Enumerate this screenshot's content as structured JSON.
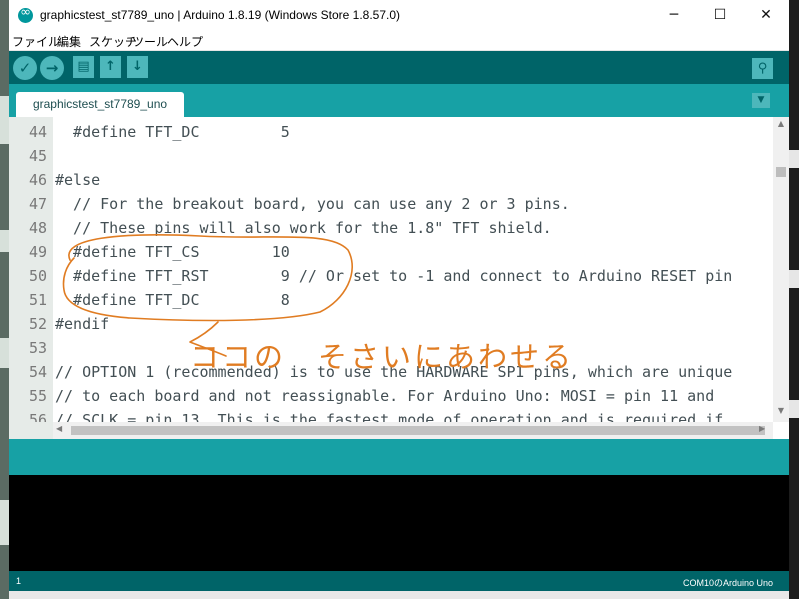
{
  "window": {
    "title": "graphicstest_st7789_uno | Arduino 1.8.19 (Windows Store 1.8.57.0)",
    "min_glyph": "─",
    "max_glyph": "☐",
    "close_glyph": "✕"
  },
  "menu": [
    "ファイル",
    "編集",
    "スケッチ",
    "ツール",
    "ヘルプ"
  ],
  "toolbar": {
    "verify_glyph": "✓",
    "upload_glyph": "→",
    "new_glyph": "▤",
    "open_glyph": "↑",
    "save_glyph": "↓",
    "serial_glyph": "⚲"
  },
  "tab": {
    "label": "graphicstest_st7789_uno",
    "menu_glyph": "▼"
  },
  "code_lines": [
    {
      "num": "44",
      "text": "  #define TFT_DC         5"
    },
    {
      "num": "45",
      "text": ""
    },
    {
      "num": "46",
      "text": "#else"
    },
    {
      "num": "47",
      "text": "  // For the breakout board, you can use any 2 or 3 pins."
    },
    {
      "num": "48",
      "text": "  // These pins will also work for the 1.8\" TFT shield."
    },
    {
      "num": "49",
      "text": "  #define TFT_CS        10"
    },
    {
      "num": "50",
      "text": "  #define TFT_RST        9 // Or set to -1 and connect to Arduino RESET pin"
    },
    {
      "num": "51",
      "text": "  #define TFT_DC         8"
    },
    {
      "num": "52",
      "text": "#endif"
    },
    {
      "num": "53",
      "text": ""
    },
    {
      "num": "54",
      "text": "// OPTION 1 (recommended) is to use the HARDWARE SPI pins, which are unique"
    },
    {
      "num": "55",
      "text": "// to each board and not reassignable. For Arduino Uno: MOSI = pin 11 and"
    },
    {
      "num": "56",
      "text": "// SCLK = pin 13. This is the fastest mode of operation and is required if"
    }
  ],
  "scroll": {
    "up_glyph": "▲",
    "down_glyph": "▼",
    "left_glyph": "◀",
    "right_glyph": "▶"
  },
  "annotation": {
    "text": "ココの　そさいにあわせる",
    "color": "#e07c22"
  },
  "status": {
    "line": "1",
    "board": "COM10のArduino Uno"
  },
  "colors": {
    "toolbar": "#006468",
    "tabbar": "#17a1a5",
    "button": "#4db7bb",
    "console": "#000000"
  }
}
